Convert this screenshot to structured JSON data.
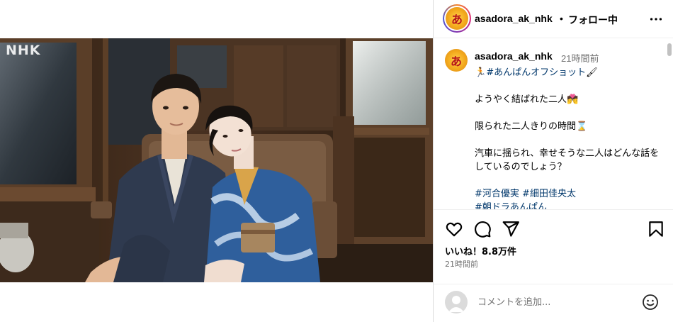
{
  "post": {
    "photo_watermark": "NHK",
    "photo_alt": "two actors in kimono sitting on a wooden train bench"
  },
  "header": {
    "username": "asadora_ak_nhk",
    "separator": "•",
    "follow_label": "フォロー中",
    "avatar_glyph": "あ",
    "more_icon": "more-horizontal-icon"
  },
  "caption": {
    "username": "asadora_ak_nhk",
    "time": "21時間前",
    "line1_prefix_emoji": "🏃",
    "line1_tag": "#あんぱんオフショット",
    "line1_suffix_emoji": "🖌",
    "line2": "ようやく結ばれた二人💏",
    "line3": "限られた二人きりの時間⌛",
    "line4": "汽車に揺られ、幸せそうな二人はどんな話をしているのでしょう？",
    "tags": [
      "#河合優実",
      "#細田佳央太",
      "#朝ドラあんぱん"
    ]
  },
  "actions": {
    "like_icon": "heart-icon",
    "comment_icon": "comment-icon",
    "share_icon": "send-icon",
    "save_icon": "bookmark-icon",
    "likes_text": "いいね！8.8万件",
    "timestamp": "21時間前"
  },
  "comment": {
    "placeholder": "コメントを追加...",
    "emoji_icon": "emoji-smile-icon"
  }
}
